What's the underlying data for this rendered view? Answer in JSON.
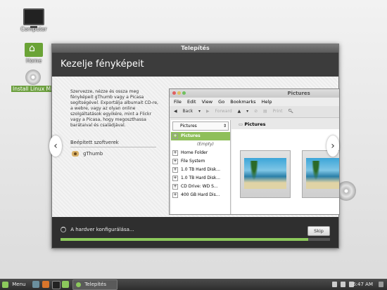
{
  "desktop": {
    "icons": [
      {
        "label": "Computer"
      },
      {
        "label": "Home"
      },
      {
        "label": "Install Linux Mint"
      }
    ]
  },
  "window": {
    "title": "Telepítés",
    "heading": "Kezelje fényképeit",
    "description": "Szervezze, nézze és ossza meg fényképeit gThumb vagy a Picasa segítségével. Exportálja albumait CD-re, a webre, vagy az olyan online szolgáltatások egyikére, mint a Flickr vagy a Picasa, hogy megoszthassa barátaival és családjával.",
    "apps_title": "Beépített szoftverek",
    "app_name": "gThumb",
    "prev_label": "‹",
    "next_label": "›",
    "status": "A hardver konfigurálása...",
    "skip_label": "Skip",
    "progress": 0.92
  },
  "nautilus": {
    "title": "Pictures",
    "menu": [
      "File",
      "Edit",
      "View",
      "Go",
      "Bookmarks",
      "Help"
    ],
    "toolbar": {
      "back": "Back",
      "forward": "Forward",
      "print": "Print"
    },
    "combo": "Pictures",
    "location": "Pictures",
    "tree": [
      {
        "label": "Pictures",
        "sel": true
      },
      {
        "label": "(Empty)",
        "empty": true
      },
      {
        "label": "Home Folder"
      },
      {
        "label": "File System"
      },
      {
        "label": "1.0 TB Hard Disk..."
      },
      {
        "label": "1.0 TB Hard Disk..."
      },
      {
        "label": "CD Drive: WD S..."
      },
      {
        "label": "400 GB Hard Dis..."
      }
    ]
  },
  "taskbar": {
    "menu_label": "Menu",
    "task_label": "Telepítés",
    "clock": "6:47 AM"
  },
  "colors": {
    "accent": "#8cc95c",
    "header": "#3c3c3c"
  }
}
